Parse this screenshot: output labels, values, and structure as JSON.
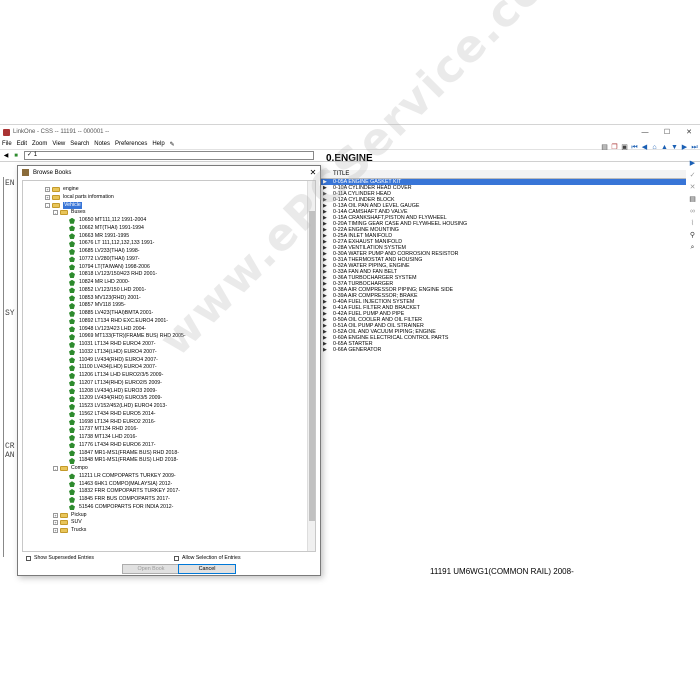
{
  "window": {
    "title": "LinkOne - CSS -- 11191 -- 000001 --",
    "min": "—",
    "max": "☐",
    "close": "✕"
  },
  "menu": [
    "File",
    "Edit",
    "Zoom",
    "View",
    "Search",
    "Notes",
    "Preferences",
    "Help"
  ],
  "toolbar": {
    "combo_value": "1"
  },
  "main": {
    "section_title": "0.ENGINE",
    "column_header": "TITLE",
    "rows": [
      "0-05A  ENGINE GASKET KIT",
      "0-10A  CYLINDER HEAD COVER",
      "0-11A  CYLINDER HEAD",
      "0-12A  CYLINDER BLOCK",
      "0-13A  OIL PAN AND LEVEL GAUGE",
      "0-14A  CAMSHAFT AND VALVE",
      "0-15A  CRANKSHAFT,PISTON AND FLYWHEEL",
      "0-20A  TIMING GEAR CASE AND FLYWHEEL HOUSING",
      "0-22A  ENGINE MOUNTING",
      "0-25A  INLET MANIFOLD",
      "0-27A  EXHAUST MANIFOLD",
      "0-28A  VENTILATION SYSTEM",
      "0-30A  WATER PUMP AND CORROSION RESISTOR",
      "0-31A  THERMOSTAT AND HOUSING",
      "0-32A  WATER PIPING, ENGINE",
      "0-33A  FAN AND FAN BELT",
      "0-36A  TURBOCHARGER SYSTEM",
      "0-37A  TURBOCHARGER",
      "0-38A  AIR COMPRESSOR PIPING; ENGINE SIDE",
      "0-39A  AIR COMPRESSOR; BRAKE",
      "0-40A  FUEL INJECTION SYSTEM",
      "0-41A  FUEL FILTER AND BRACKET",
      "0-42A  FUEL PUMP AND PIPE",
      "0-50A  OIL COOLER AND OIL FILTER",
      "0-51A  OIL PUMP AND OIL STRAINER",
      "0-52A  OIL AND VACUUM PIPING; ENGINE",
      "0-60A  ENGINE ELECTRICAL CONTROL PARTS",
      "0-65A  STARTER",
      "0-66A  GENERATOR"
    ],
    "selected_index": 0,
    "footer": "11191  UM6WG1(COMMON RAIL) 2008-"
  },
  "left_fragments": [
    "EN",
    "SY",
    "CR",
    "AN"
  ],
  "dialog": {
    "title": "Browse Books",
    "close": "✕",
    "top_nodes": [
      "engine",
      "local parts information"
    ],
    "vehicle_label": "Vehicle",
    "buses_label": "Buses",
    "buses": [
      "10650 MT111,112 1991-2004",
      "10662 MT(THAI) 1991-1994",
      "10663 MR 1991-1995",
      "10676 LT 111,112,132,133 1991-",
      "10685 LV233(THAI) 1998-",
      "10772 LV280(THAI) 1997-",
      "10794 LT(TAIWAN) 1998-2006",
      "10818 LV123/150/423 RHD 2001-",
      "10824 MR LHD 2000-",
      "10852 LV123/150 LHD 2001-",
      "10853 MV123(RHD) 2001-",
      "10857 MV118 1995-",
      "10885 LV423(THAI)BMTA 2001-",
      "10892 LT134 RHD EXC.EURO4 2001-",
      "10948 LV123/423 LHD 2004-",
      "10969 MT133(FTR)(FRAME BUS) RHD 2005-",
      "11031 LT134 RHD EURO4 2007-",
      "11032 LT134(LHD) EURO4 2007-",
      "11049 LV434(RHD) EURO4 2007-",
      "11100 LV434(LHD) EURO4 2007-",
      "11206 LT134 LHD EURO2/3/5 2009-",
      "11207 LT134(RHD) EURO2/5 2009-",
      "11208 LV434(LHD) EURO3 2009-",
      "11209 LV434(RHD) EURO3/5 2009-",
      "11523 LV152/452(LHD) EURO4 2013-",
      "11562 LT434 RHD EURO5 2014-",
      "11698 LT134 RHD EURO2 2016-",
      "11737 MT134 RHD 2016-",
      "11738 MT134 LHD 2016-",
      "11776 LT434 RHD EURO6 2017-",
      "11847 MR1-MS1(FRAME BUS) RHD 2018-",
      "11848 MR1-MS1(FRAME BUS) LHD 2018-"
    ],
    "compo_label": "Compo",
    "compo": [
      "11211 LR COMPOPARTS TURKEY 2009-",
      "11463 6HK1 COMPO(MALAYSIA) 2012-",
      "11832 FRR COMPOPARTS TURKEY 2017-",
      "11845 FRR BUS COMPOPARTS 2017-",
      "51546 COMPOPARTS FOR INDIA 2012-"
    ],
    "other_nodes": [
      "Pickup",
      "SUV",
      "Trucks"
    ],
    "show_superseded": "Show Superseded Entries",
    "allow_selection": "Allow Selection of Entries",
    "open_button": "Open Book",
    "cancel_button": "Cancel"
  },
  "watermark": "www.ePCService.com",
  "colors": {
    "selection": "#3875d7",
    "icon_blue": "#1a5fb4",
    "book_green": "#2e8b2e",
    "folder": "#e8c55a"
  }
}
